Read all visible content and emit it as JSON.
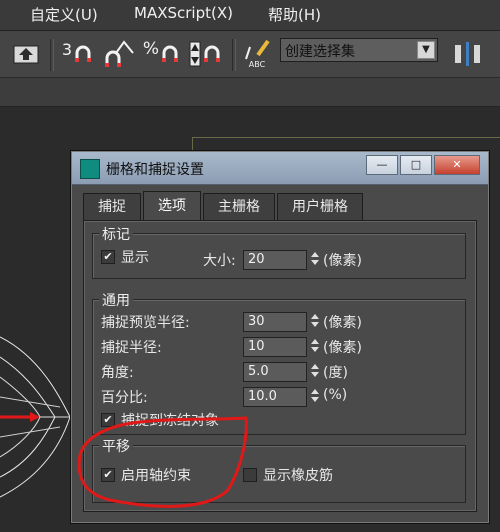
{
  "menu": {
    "items": [
      "自定义(U)",
      "MAXScript(X)",
      "帮助(H)"
    ]
  },
  "toolbar": {
    "snap_3d_label": "3",
    "angle_snap_glyph": "∠",
    "percent_snap_label": "%",
    "spinner_snap_glyph": "⇕",
    "edit_named_sel_label": "ABC",
    "named_selection_placeholder": "创建选择集"
  },
  "dialog": {
    "title": "栅格和捕捉设置",
    "tabs": [
      "捕捉",
      "选项",
      "主栅格",
      "用户栅格"
    ],
    "active_tab": "选项",
    "markers": {
      "title": "标记",
      "show_label": "显示",
      "show_checked": true,
      "size_label": "大小:",
      "size_value": "20",
      "size_unit": "(像素)"
    },
    "general": {
      "title": "通用",
      "rows": [
        {
          "label": "捕捉预览半径:",
          "value": "30",
          "unit": "(像素)"
        },
        {
          "label": "捕捉半径:",
          "value": "10",
          "unit": "(像素)"
        },
        {
          "label": "角度:",
          "value": "5.0",
          "unit": "(度)"
        },
        {
          "label": "百分比:",
          "value": "10.0",
          "unit": "(%)"
        }
      ],
      "snap_frozen_label": "捕捉到冻结对象",
      "snap_frozen_checked": true
    },
    "translation": {
      "title": "平移",
      "axis_constraint_label": "启用轴约束",
      "axis_constraint_checked": true,
      "rubber_band_label": "显示橡皮筋",
      "rubber_band_checked": false
    }
  },
  "colors": {
    "annotation_red": "#e01818",
    "title_bar": "#9fb0c4",
    "dialog_bg": "#4a4a4a"
  }
}
